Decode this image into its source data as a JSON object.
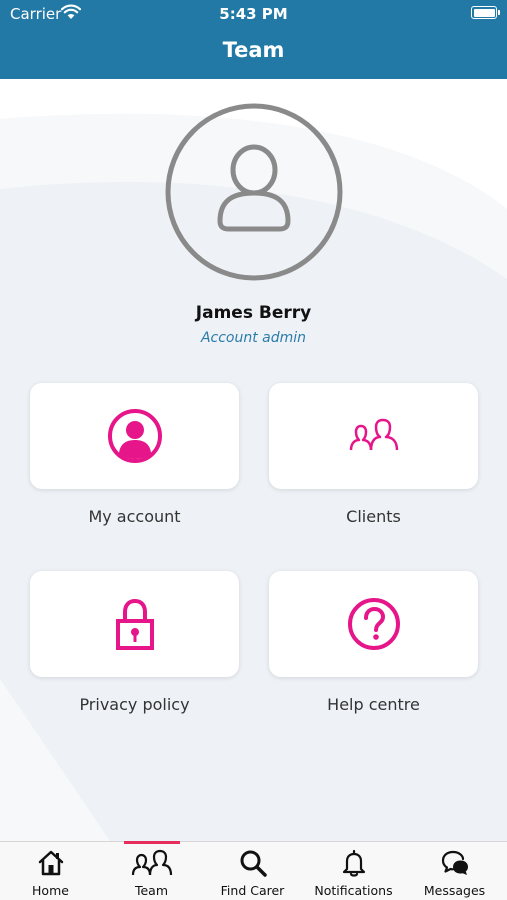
{
  "status_bar": {
    "carrier": "Carrier",
    "time": "5:43 PM"
  },
  "header": {
    "title": "Team"
  },
  "profile": {
    "name": "James Berry",
    "role": "Account admin",
    "avatar_icon": "user-icon"
  },
  "menu": [
    {
      "label": "My account",
      "icon": "account-circle-icon"
    },
    {
      "label": "Clients",
      "icon": "clients-icon"
    },
    {
      "label": "Privacy policy",
      "icon": "lock-icon"
    },
    {
      "label": "Help centre",
      "icon": "help-icon"
    }
  ],
  "tabs": [
    {
      "label": "Home",
      "icon": "home-icon"
    },
    {
      "label": "Team",
      "icon": "team-icon",
      "active": true
    },
    {
      "label": "Find Carer",
      "icon": "search-icon"
    },
    {
      "label": "Notifications",
      "icon": "bell-icon"
    },
    {
      "label": "Messages",
      "icon": "messages-icon"
    }
  ],
  "colors": {
    "header": "#2279a6",
    "accent": "#e6158a",
    "active_tab": "#e62e5c",
    "role_text": "#2c7ca9"
  }
}
